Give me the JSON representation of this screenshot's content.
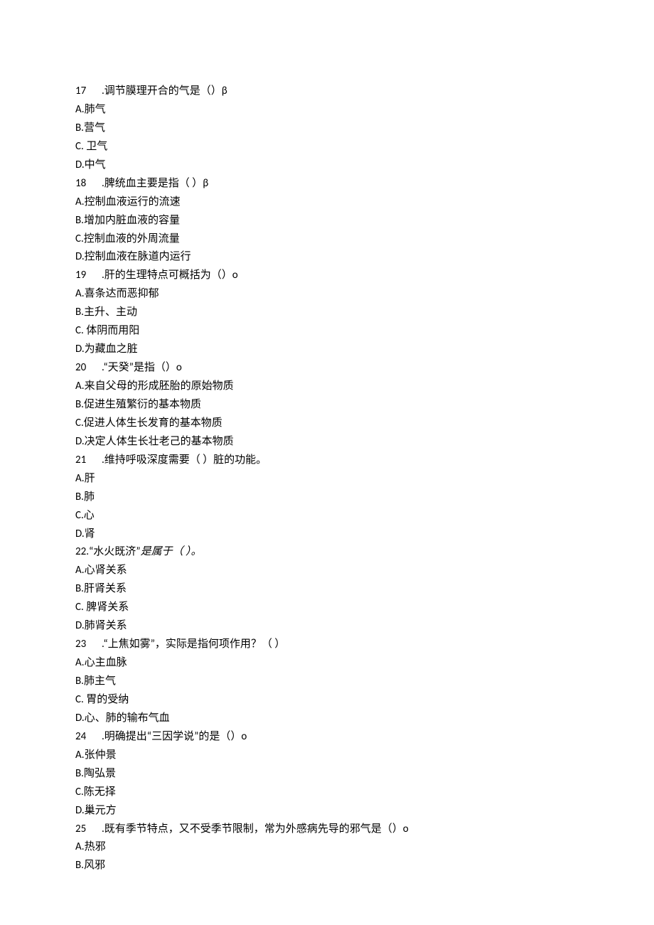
{
  "questions": [
    {
      "num": "17",
      "dot_style": "padded",
      "stem_parts": [
        {
          "text": ".调节膜理开合的气是（）",
          "italic": false
        },
        {
          "text": "β",
          "italic": false,
          "sub": false
        }
      ],
      "options": [
        {
          "letter": "A.",
          "text": "肺气"
        },
        {
          "letter": "B.",
          "text": "营气"
        },
        {
          "letter": "C. ",
          "text": "卫气"
        },
        {
          "letter": "D.",
          "text": "中气"
        }
      ]
    },
    {
      "num": "18",
      "dot_style": "padded",
      "stem_parts": [
        {
          "text": ".脾统血主要是指（   ）",
          "italic": false
        },
        {
          "text": "β",
          "italic": false
        }
      ],
      "options": [
        {
          "letter": "A.",
          "text": "控制血液运行的流速"
        },
        {
          "letter": "B.",
          "text": "增加内脏血液的容量"
        },
        {
          "letter": "C.",
          "text": "控制血液的外周流量"
        },
        {
          "letter": "D.",
          "text": "控制血液在脉道内运行"
        }
      ]
    },
    {
      "num": "19",
      "dot_style": "padded",
      "stem_parts": [
        {
          "text": ".肝的生理特点可概括为（）o",
          "italic": false
        }
      ],
      "options": [
        {
          "letter": "A.",
          "text": "喜条达而恶抑郁"
        },
        {
          "letter": "B.",
          "text": "主升、主动"
        },
        {
          "letter": "C. ",
          "text": "体阴而用阳"
        },
        {
          "letter": "D.",
          "text": "为藏血之脏"
        }
      ]
    },
    {
      "num": "20",
      "dot_style": "padded",
      "stem_parts": [
        {
          "text": ".“天癸”是指（）o",
          "italic": false
        }
      ],
      "options": [
        {
          "letter": "A.",
          "text": "来自父母的形成胚胎的原始物质"
        },
        {
          "letter": "B.",
          "text": "促进生殖繁衍的基本物质"
        },
        {
          "letter": "C.",
          "text": "促进人体生长发育的基本物质"
        },
        {
          "letter": "D.",
          "text": "决定人体生长壮老己的基本物质"
        }
      ]
    },
    {
      "num": "21",
      "dot_style": "padded",
      "stem_parts": [
        {
          "text": ".维持呼吸深度需要（    ）脏的功能。",
          "italic": false
        }
      ],
      "options": [
        {
          "letter": "A.",
          "text": "肝"
        },
        {
          "letter": "B.",
          "text": "肺"
        },
        {
          "letter": "C.",
          "text": "心"
        },
        {
          "letter": "D.",
          "text": "肾"
        }
      ]
    },
    {
      "num": "22.",
      "dot_style": "inline",
      "stem_parts": [
        {
          "text": "“水火既济”",
          "italic": false
        },
        {
          "text": "是属于（        ）。",
          "italic": true
        }
      ],
      "options": [
        {
          "letter": "A.",
          "text": "心肾关系"
        },
        {
          "letter": "B.",
          "text": "肝肾关系"
        },
        {
          "letter": "C. ",
          "text": "脾肾关系"
        },
        {
          "letter": "D.",
          "text": "肺肾关系"
        }
      ]
    },
    {
      "num": "23",
      "dot_style": "padded",
      "stem_parts": [
        {
          "text": ".“上焦如雾”，实际是指何项作用？（    ）",
          "italic": false
        }
      ],
      "options": [
        {
          "letter": "A.",
          "text": "心主血脉"
        },
        {
          "letter": "B.",
          "text": "肺主气"
        },
        {
          "letter": "C. ",
          "text": "胃的受纳"
        },
        {
          "letter": "D.",
          "text": "心、肺的输布气血"
        }
      ]
    },
    {
      "num": "24",
      "dot_style": "padded",
      "stem_parts": [
        {
          "text": ".明确提出“三因学说”的是（）o",
          "italic": false
        }
      ],
      "options": [
        {
          "letter": "A.",
          "text": "张仲景"
        },
        {
          "letter": "B.",
          "text": "陶弘景"
        },
        {
          "letter": "C.",
          "text": "陈无择"
        },
        {
          "letter": "D.",
          "text": "巢元方"
        }
      ]
    },
    {
      "num": "25",
      "dot_style": "padded",
      "stem_parts": [
        {
          "text": ".既有季节特点，又不受季节限制，常为外感病先导的邪气是（）o",
          "italic": false
        }
      ],
      "options": [
        {
          "letter": "A.",
          "text": "热邪"
        },
        {
          "letter": "B.",
          "text": "风邪"
        }
      ]
    }
  ]
}
